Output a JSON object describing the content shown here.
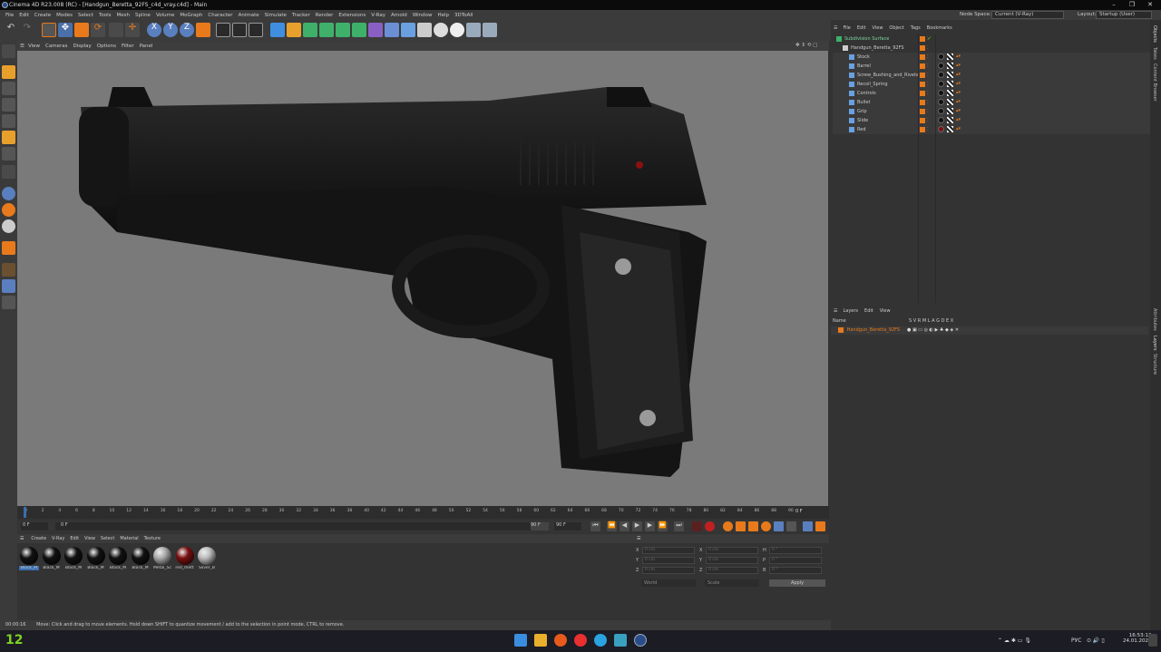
{
  "window": {
    "title": "Cinema 4D R23.008 (RC) - [Handgun_Beretta_92FS_c4d_vray.c4d] - Main"
  },
  "menu": [
    "File",
    "Edit",
    "Create",
    "Modes",
    "Select",
    "Tools",
    "Mesh",
    "Spline",
    "Volume",
    "MoGraph",
    "Character",
    "Animate",
    "Simulate",
    "Tracker",
    "Render",
    "Extensions",
    "V-Ray",
    "Arnold",
    "Window",
    "Help",
    "3DToAll"
  ],
  "node_space": {
    "label": "Node Space:",
    "value": "Current (V-Ray)"
  },
  "layout": {
    "label": "Layout:",
    "value": "Startup (User)"
  },
  "viewport_menu": [
    "View",
    "Cameras",
    "Display",
    "Options",
    "Filter",
    "Panel"
  ],
  "timeline": {
    "ticks": [
      "0",
      "2",
      "4",
      "6",
      "8",
      "10",
      "12",
      "14",
      "16",
      "18",
      "20",
      "22",
      "24",
      "26",
      "28",
      "30",
      "32",
      "34",
      "36",
      "38",
      "40",
      "42",
      "44",
      "46",
      "48",
      "50",
      "52",
      "54",
      "56",
      "58",
      "60",
      "62",
      "64",
      "66",
      "68",
      "70",
      "72",
      "74",
      "76",
      "78",
      "80",
      "82",
      "84",
      "86",
      "88",
      "90"
    ],
    "current": "0 F"
  },
  "transport": {
    "start": "0 F",
    "field2": "0 F",
    "end": "90 F",
    "end2": "90 F"
  },
  "materials": {
    "menu": [
      "Create",
      "V-Ray",
      "Edit",
      "View",
      "Select",
      "Material",
      "Texture"
    ],
    "items": [
      {
        "label": "Black_M",
        "color": "#111"
      },
      {
        "label": "Black_M",
        "color": "#111"
      },
      {
        "label": "Black_M",
        "color": "#111"
      },
      {
        "label": "Black_M",
        "color": "#111"
      },
      {
        "label": "Black_M",
        "color": "#111"
      },
      {
        "label": "Black_M",
        "color": "#111"
      },
      {
        "label": "Metal_Sc",
        "color": "#aaa"
      },
      {
        "label": "red_mett",
        "color": "#7a1010"
      },
      {
        "label": "Silver_B",
        "color": "#bbb"
      }
    ]
  },
  "coords": {
    "rows": [
      {
        "a": "X",
        "v1": "0 cm",
        "b": "X",
        "v2": "0 cm",
        "c": "H",
        "v3": "0 °"
      },
      {
        "a": "Y",
        "v1": "0 cm",
        "b": "Y",
        "v2": "0 cm",
        "c": "P",
        "v3": "0 °"
      },
      {
        "a": "Z",
        "v1": "0 cm",
        "b": "Z",
        "v2": "0 cm",
        "c": "B",
        "v3": "0 °"
      }
    ],
    "mode1": "World",
    "mode2": "Scale",
    "apply": "Apply"
  },
  "status": {
    "time": "00:00:16",
    "message": "Move: Click and drag to move elements. Hold down SHIFT to quantize movement / add to the selection in point mode, CTRL to remove."
  },
  "object_manager": {
    "menu": [
      "File",
      "Edit",
      "View",
      "Object",
      "Tags",
      "Bookmarks"
    ],
    "objects": [
      {
        "name": "Subdivision Surface",
        "indent": 0
      },
      {
        "name": "Handgun_Beretta_92FS",
        "indent": 1
      },
      {
        "name": "Stock",
        "indent": 2
      },
      {
        "name": "Barrel",
        "indent": 2
      },
      {
        "name": "Screw_Bushing_and_Rivets",
        "indent": 2
      },
      {
        "name": "Recoil_Spring",
        "indent": 2
      },
      {
        "name": "Controls",
        "indent": 2
      },
      {
        "name": "Bullet",
        "indent": 2
      },
      {
        "name": "Grip",
        "indent": 2
      },
      {
        "name": "Slide",
        "indent": 2
      },
      {
        "name": "Red",
        "indent": 2
      }
    ]
  },
  "layers": {
    "menu": [
      "Layers",
      "Edit",
      "View"
    ],
    "header_name": "Name",
    "header_flags": "S V R M L A G D E X",
    "items": [
      "Handgun_Beretta_92FS"
    ]
  },
  "right_tabs": [
    "Objects",
    "Takes",
    "Content Browser",
    "Attributes",
    "Layers",
    "Structure"
  ],
  "taskbar": {
    "left_badge": "12",
    "lang": "РУС",
    "time": "16:53:13",
    "date": "24.01.2025"
  },
  "colors": {
    "accent": "#e87a1c",
    "select": "#3a6fb0"
  }
}
